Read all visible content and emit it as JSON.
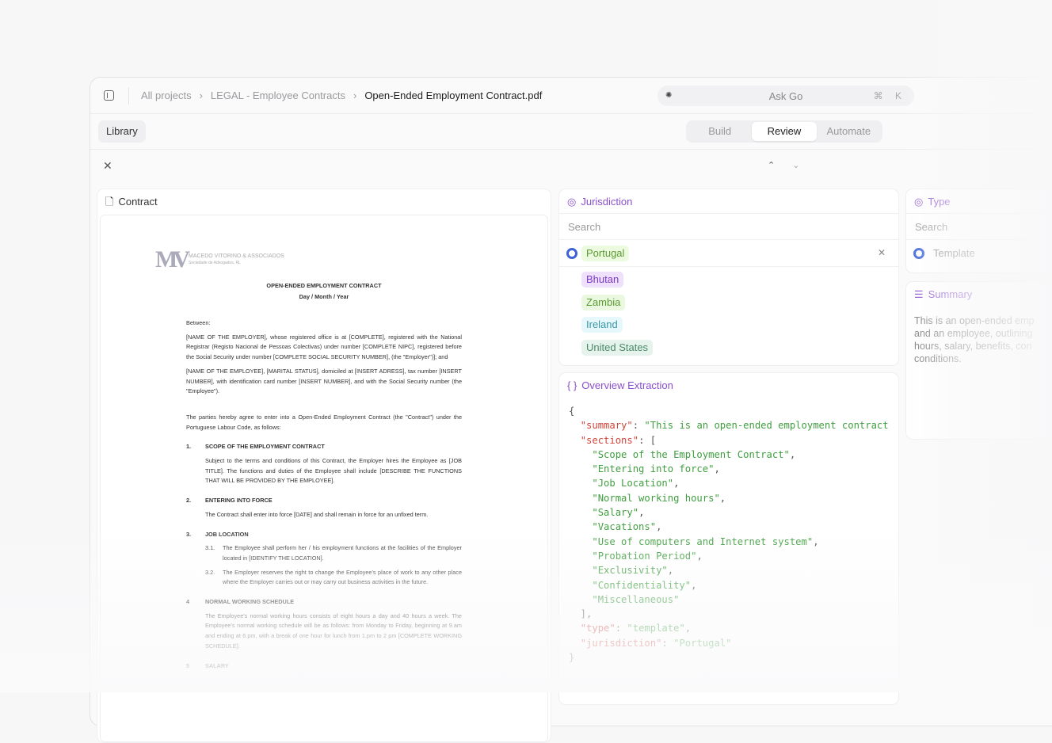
{
  "header": {
    "breadcrumbs": [
      "All projects",
      "LEGAL - Employee Contracts",
      "Open-Ended Employment Contract.pdf"
    ],
    "ask": "Ask Go",
    "shortcut": "⌘ K"
  },
  "toolbar": {
    "library": "Library",
    "tabs": [
      "Build",
      "Review",
      "Automate"
    ],
    "active_tab": "Review"
  },
  "contract": {
    "title": "Contract",
    "logo": [
      "MACEDO VITORINO & ASSOCIADOS",
      "Sociedade de Advogados, RL"
    ],
    "doc_title": "OPEN-ENDED EMPLOYMENT CONTRACT",
    "doc_date": "Day / Month / Year",
    "between": "Between:",
    "p1": "[NAME OF THE EMPLOYER], whose registered office is at [COMPLETE], registered with the National Registrar (Registo Nacional de Pessoas Colectivas) under number [COMPLETE NIPC], registered before the Social Security under number [COMPLETE SOCIAL SECURITY NUMBER], (the \"Employer\")]; and",
    "p2": "[NAME OF THE EMPLOYEE], [MARITAL STATUS], domiciled at [INSERT ADRESS], tax number [INSERT NUMBER], with identification card number [INSERT NUMBER], and with the Social Security number (the \"Employee\").",
    "p3": "The parties hereby agree to enter into a Open-Ended Employment Contract (the \"Contract\") under the Portuguese Labour Code, as follows:",
    "sections": [
      {
        "n": "1.",
        "title": "SCOPE OF THE EMPLOYMENT CONTRACT",
        "body": "Subject to the terms and conditions of this Contract, the Employer hires the Employee as [JOB TITLE]. The functions and duties of the Employee shall include [DESCRIBE THE FUNCTIONS THAT WILL BE PROVIDED BY THE EMPLOYEE]."
      },
      {
        "n": "2.",
        "title": "ENTERING INTO FORCE",
        "body": "The Contract shall enter into force [DATE] and shall remain in force for an unfixed term."
      },
      {
        "n": "3.",
        "title": "JOB LOCATION",
        "subs": [
          {
            "n": "3.1.",
            "t": "The Employee shall perform her / his employment functions at the facilities of the Employer located in [IDENTIFY THE LOCATION]."
          },
          {
            "n": "3.2.",
            "t": "The Employer reserves the right to change the Employee's place of work to any other place where the Employer carries out or may carry out business activities in the future."
          }
        ]
      },
      {
        "n": "4",
        "title": "NORMAL WORKING SCHEDULE",
        "body": "The Employee's normal working hours consists of eight hours a day and 40 hours a week. The Employee's normal working schedule will be as follows: from Monday to Friday, beginning at 9.am and ending at 6.pm, with a break of one hour for lunch from 1.pm to 2 pm [COMPLETE WORKING SCHEDULE]."
      },
      {
        "n": "5",
        "title": "SALARY"
      }
    ]
  },
  "jurisdiction": {
    "title": "Jurisdiction",
    "search_placeholder": "Search",
    "selected": "Portugal",
    "options": [
      {
        "label": "Bhutan",
        "bg": "#efe0fb",
        "fg": "#7a3cc4"
      },
      {
        "label": "Zambia",
        "bg": "#e9f8df",
        "fg": "#5c9a33"
      },
      {
        "label": "Ireland",
        "bg": "#e6f8fb",
        "fg": "#3a97a8"
      },
      {
        "label": "United States",
        "bg": "#e6f3ec",
        "fg": "#4a8a66"
      }
    ],
    "selected_colors": {
      "bg": "#ecfadf",
      "fg": "#5c9a33"
    }
  },
  "overview": {
    "title": "Overview Extraction",
    "icon": "{ }",
    "json_lines": [
      [
        "{"
      ],
      [
        "  ",
        "\"summary\"",
        ": ",
        "\"This is an open-ended employment contract"
      ],
      [
        "  ",
        "\"sections\"",
        ": ["
      ],
      [
        "    ",
        "",
        "",
        "\"Scope of the Employment Contract\"",
        ","
      ],
      [
        "    ",
        "",
        "",
        "\"Entering into force\"",
        ","
      ],
      [
        "    ",
        "",
        "",
        "\"Job Location\"",
        ","
      ],
      [
        "    ",
        "",
        "",
        "\"Normal working hours\"",
        ","
      ],
      [
        "    ",
        "",
        "",
        "\"Salary\"",
        ","
      ],
      [
        "    ",
        "",
        "",
        "\"Vacations\"",
        ","
      ],
      [
        "    ",
        "",
        "",
        "\"Use of computers and Internet system\"",
        ","
      ],
      [
        "    ",
        "",
        "",
        "\"Probation Period\"",
        ","
      ],
      [
        "    ",
        "",
        "",
        "\"Exclusivity\"",
        ","
      ],
      [
        "    ",
        "",
        "",
        "\"Confidentiality\"",
        ","
      ],
      [
        "    ",
        "",
        "",
        "\"Miscellaneous\""
      ],
      [
        "  ],"
      ],
      [
        "  ",
        "\"type\"",
        ": ",
        "\"template\"",
        ","
      ],
      [
        "  ",
        "\"jurisdiction\"",
        ": ",
        "\"Portugal\""
      ],
      [
        "}"
      ]
    ]
  },
  "type": {
    "title": "Type",
    "search_placeholder": "Search",
    "selected": "Template"
  },
  "summary": {
    "title": "Summary",
    "lines": [
      "This is an open-ended emp",
      "and an employee, outlining",
      "hours, salary, benefits, con",
      "conditions."
    ]
  },
  "colors": {
    "accent": "#8a4fd0",
    "radio": "#3b63d6"
  }
}
